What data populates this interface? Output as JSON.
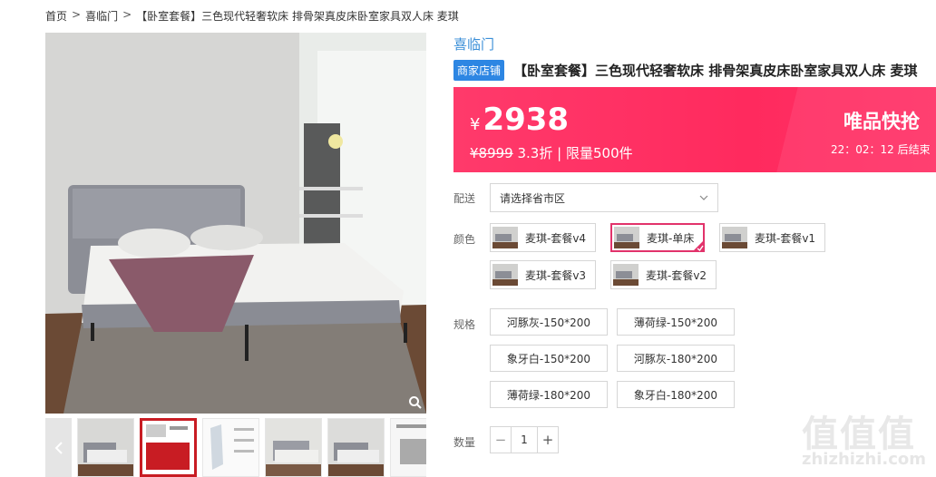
{
  "breadcrumb": {
    "home": "首页",
    "shop": "喜临门",
    "product": "【卧室套餐】三色现代轻奢软床 排骨架真皮床卧室家具双人床 麦琪",
    "separator": ">"
  },
  "shop": {
    "name": "喜临门",
    "badge": "商家店铺"
  },
  "product": {
    "title": "【卧室套餐】三色现代轻奢软床 排骨架真皮床卧室家具双人床 麦琪"
  },
  "price": {
    "currency": "¥",
    "current": "2938",
    "original": "¥8999",
    "discount": "3.3折",
    "limit_sep": "|",
    "limit": "限量500件"
  },
  "flash_sale": {
    "title": "唯品快抢",
    "timer": "22：02：12",
    "ends": "后结束"
  },
  "delivery": {
    "label": "配送",
    "placeholder": "请选择省市区"
  },
  "color": {
    "label": "颜色",
    "options": [
      "麦琪-套餐v4",
      "麦琪-单床",
      "麦琪-套餐v1",
      "麦琪-套餐v3",
      "麦琪-套餐v2"
    ],
    "selected": "麦琪-单床"
  },
  "spec": {
    "label": "规格",
    "options": [
      "河豚灰-150*200",
      "薄荷绿-150*200",
      "象牙白-150*200",
      "河豚灰-180*200",
      "薄荷绿-180*200",
      "象牙白-180*200"
    ]
  },
  "quantity": {
    "label": "数量",
    "value": "1",
    "minus": "−",
    "plus": "+"
  },
  "watermark": {
    "logo": "值值值",
    "url": "zhizhizhi.com"
  },
  "colors": {
    "accent": "#ff2a5e",
    "link": "#3b8fd8",
    "badge": "#2d86e3",
    "selected_border": "#e2336b"
  }
}
